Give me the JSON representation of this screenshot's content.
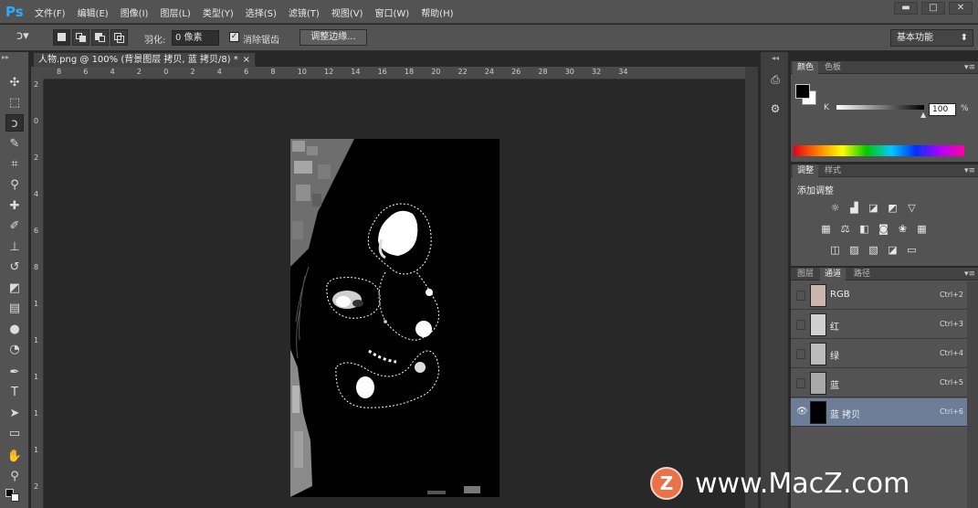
{
  "app": {
    "logo": "Ps"
  },
  "menu": [
    "文件(F)",
    "编辑(E)",
    "图像(I)",
    "图层(L)",
    "类型(Y)",
    "选择(S)",
    "滤镜(T)",
    "视图(V)",
    "窗口(W)",
    "帮助(H)"
  ],
  "window_controls": {
    "minimize": "▬",
    "restore": "□",
    "close": "✕"
  },
  "options": {
    "feather_label": "羽化:",
    "feather_value": "0 像素",
    "antialias_label": "消除锯齿",
    "refine_edge": "调整边缘...",
    "workspace": "基本功能"
  },
  "document": {
    "tab_title": "人物.png @ 100% (背景图层 拷贝, 蓝 拷贝/8) *",
    "close": "×",
    "h_ruler": [
      "8",
      "6",
      "4",
      "2",
      "0",
      "2",
      "4",
      "6",
      "8",
      "10",
      "12",
      "14",
      "16",
      "18",
      "20",
      "22",
      "24",
      "26",
      "28",
      "30",
      "32",
      "34"
    ],
    "v_ruler": [
      "2",
      "0",
      "2",
      "4",
      "6",
      "8",
      "1",
      "1",
      "1",
      "1",
      "1",
      "2"
    ]
  },
  "color_panel": {
    "tabs": [
      "颜色",
      "色板"
    ],
    "channel_label": "K",
    "value": "100",
    "unit": "%",
    "foreground": "#000000",
    "background": "#ffffff"
  },
  "adjust_panel": {
    "tabs": [
      "调整",
      "样式"
    ],
    "heading": "添加调整",
    "row1": [
      "brightness-icon",
      "levels-icon",
      "curves-icon",
      "exposure-icon",
      "vibrance-icon"
    ],
    "row2": [
      "hue-icon",
      "balance-icon",
      "bw-icon",
      "photo-filter-icon",
      "mixer-icon",
      "lookup-icon"
    ],
    "row3": [
      "invert-icon",
      "posterize-icon",
      "threshold-icon",
      "selective-color-icon",
      "gradient-map-icon"
    ]
  },
  "channels_panel": {
    "tabs": [
      "图层",
      "通道",
      "路径"
    ],
    "channels": [
      {
        "name": "RGB",
        "shortcut": "Ctrl+2",
        "visible": false,
        "selected": false
      },
      {
        "name": "红",
        "shortcut": "Ctrl+3",
        "visible": false,
        "selected": false
      },
      {
        "name": "绿",
        "shortcut": "Ctrl+4",
        "visible": false,
        "selected": false
      },
      {
        "name": "蓝",
        "shortcut": "Ctrl+5",
        "visible": false,
        "selected": false
      },
      {
        "name": "蓝 拷贝",
        "shortcut": "Ctrl+6",
        "visible": true,
        "selected": true
      }
    ]
  },
  "watermark": {
    "text": "www.MacZ.com",
    "badge": "Z"
  },
  "colors": {
    "accent": "#31a8ff",
    "selected_row": "#6d7d98",
    "watermark_badge": "#e8734a"
  }
}
